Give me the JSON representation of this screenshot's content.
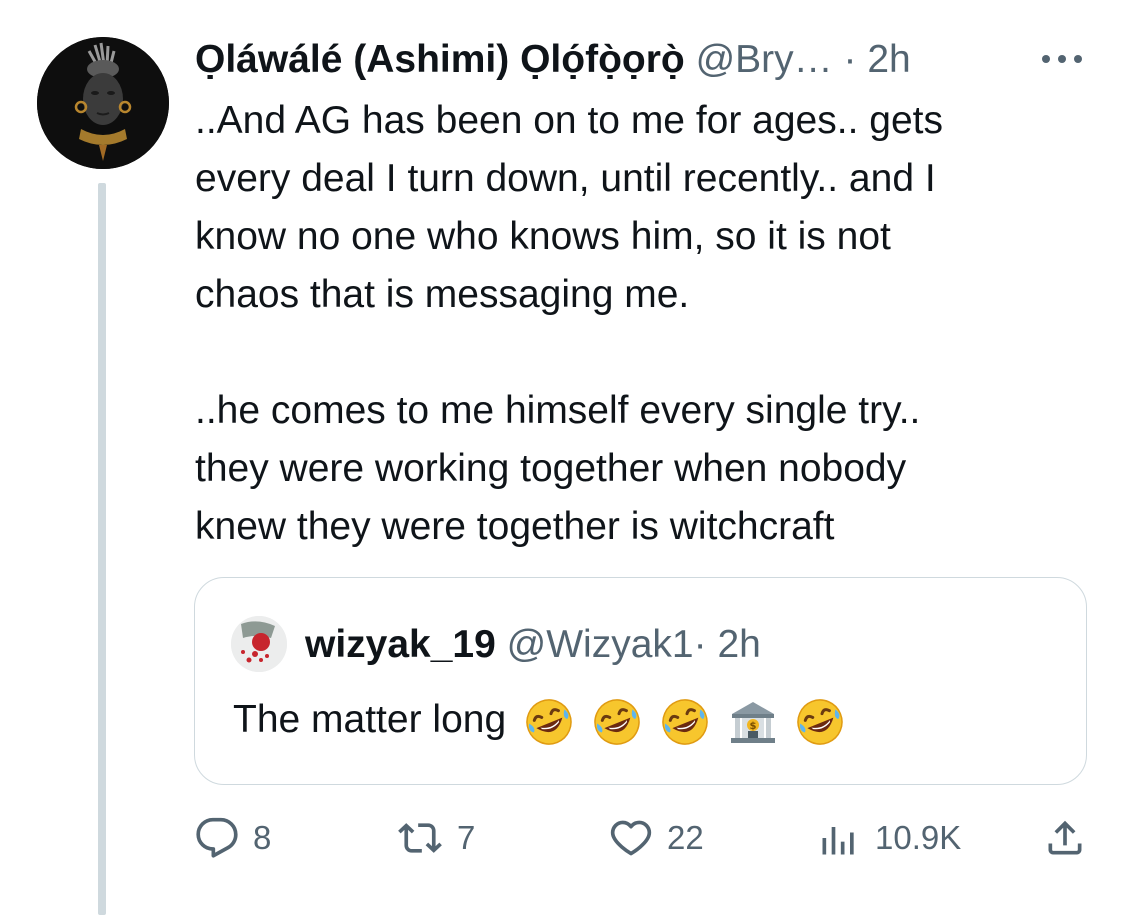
{
  "tweet": {
    "author_name": "Ọláwálé (Ashimi) Ọlọ́fọ̀ọrọ̀",
    "handle": "@Bry…",
    "separator": "·",
    "time": "2h",
    "more_icon": "more-horizontal-icon",
    "text": "..And AG has been on to me for ages.. gets\nevery deal I turn down, until recently.. and I\nknow no one who knows him, so it is not\nchaos that is messaging me.\n\n..he comes to me himself every single try..\nthey were working together when nobody\nknew they were together is witchcraft"
  },
  "quote": {
    "author_name": "wizyak_19",
    "handle": "@Wizyak1",
    "separator": "·",
    "time": "2h",
    "text": "The matter long",
    "emojis": [
      "rofl-emoji",
      "rofl-emoji",
      "rofl-emoji",
      "bank-emoji",
      "rofl-emoji"
    ]
  },
  "actions": {
    "replies": "8",
    "retweets": "7",
    "likes": "22",
    "views": "10.9K"
  },
  "colors": {
    "text": "#0f1419",
    "secondary": "#536471",
    "border": "#cfd9de",
    "thread_line": "#cfd9de"
  }
}
